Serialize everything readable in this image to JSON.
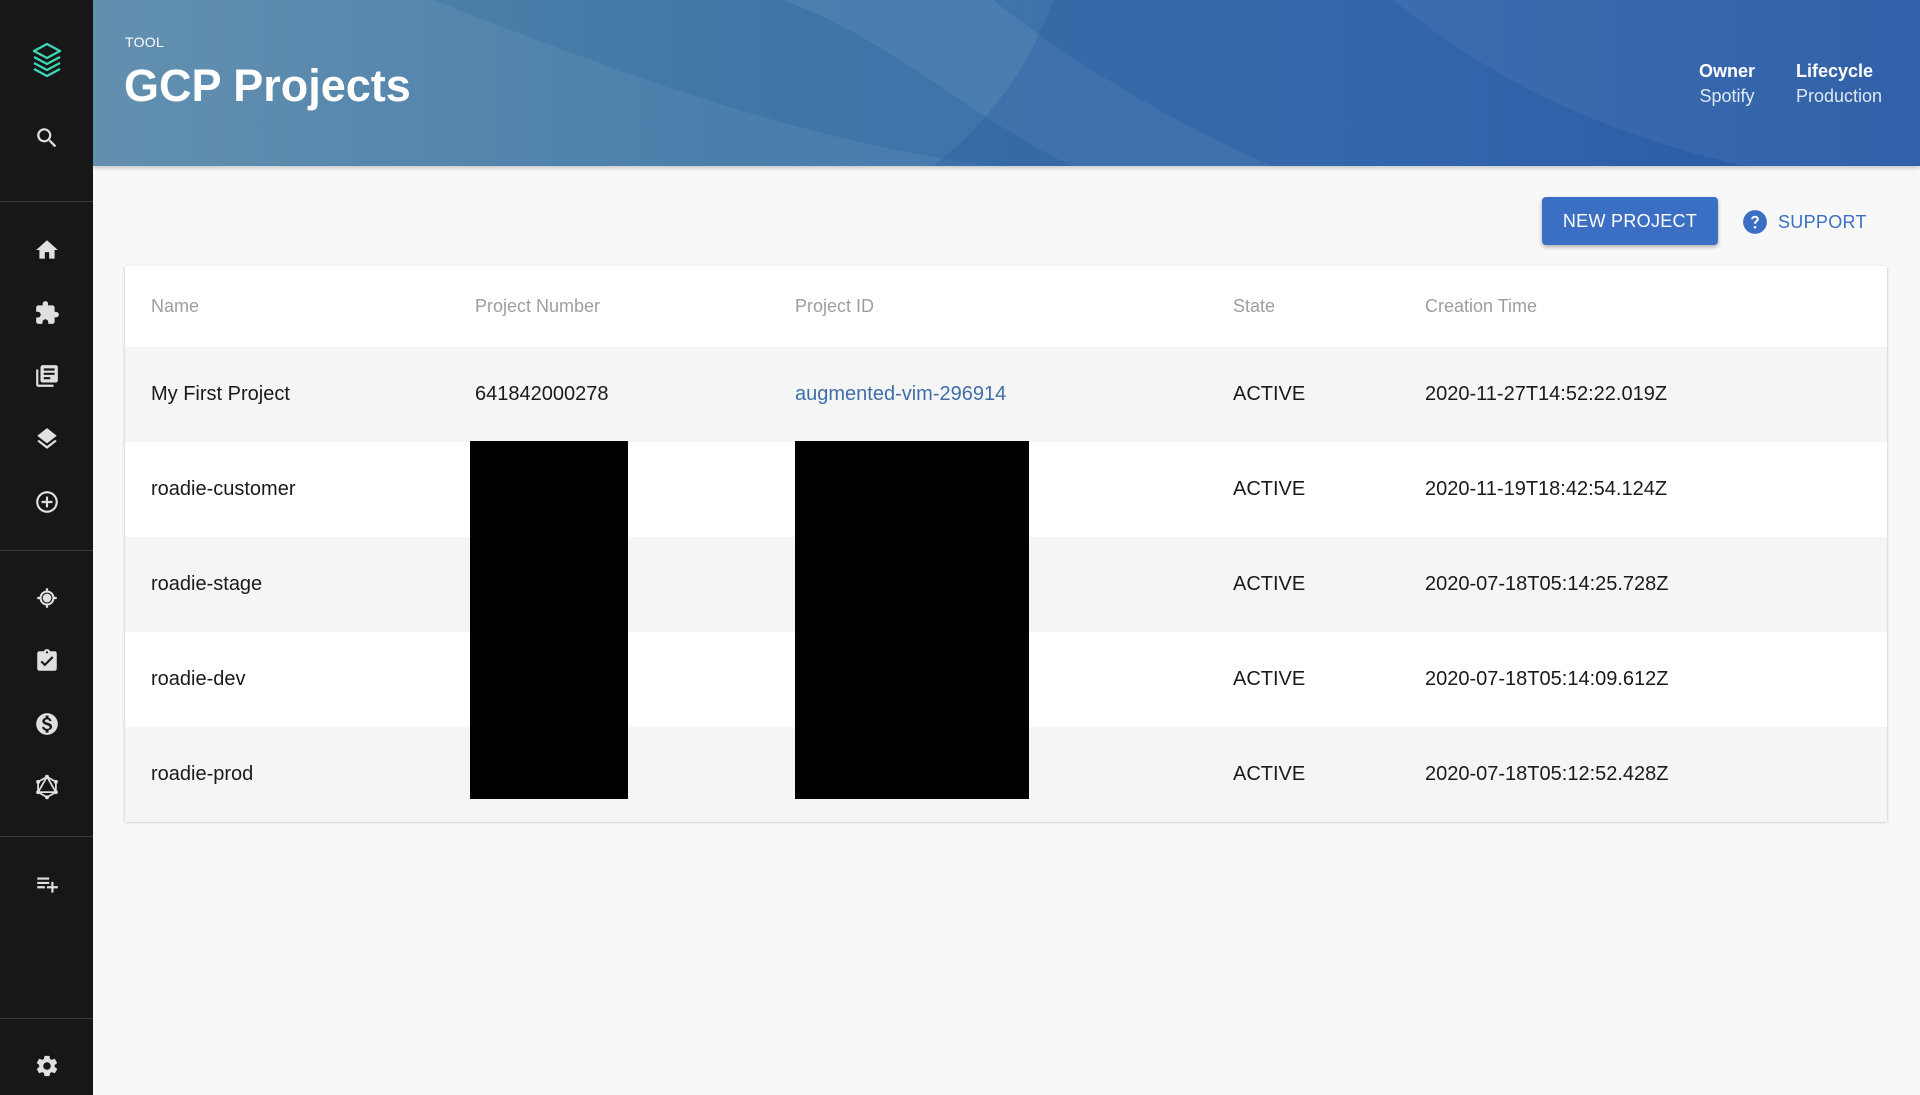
{
  "sidebar": {
    "items": [
      {
        "icon": "logo-icon"
      },
      {
        "icon": "search-icon"
      },
      {
        "icon": "home-icon"
      },
      {
        "icon": "puzzle-icon"
      },
      {
        "icon": "library-books-icon"
      },
      {
        "icon": "layers-icon"
      },
      {
        "icon": "add-circle-icon"
      },
      {
        "icon": "target-icon"
      },
      {
        "icon": "assignment-check-icon"
      },
      {
        "icon": "dollar-icon"
      },
      {
        "icon": "graphql-icon"
      },
      {
        "icon": "playlist-add-icon"
      },
      {
        "icon": "settings-icon"
      }
    ]
  },
  "header": {
    "type_label": "TOOL",
    "title": "GCP Projects",
    "owner_label": "Owner",
    "owner_value": "Spotify",
    "lifecycle_label": "Lifecycle",
    "lifecycle_value": "Production"
  },
  "actions": {
    "new_project": "NEW PROJECT",
    "support": "SUPPORT"
  },
  "table": {
    "columns": [
      "Name",
      "Project Number",
      "Project ID",
      "State",
      "Creation Time"
    ],
    "rows": [
      {
        "name": "My First Project",
        "number": "641842000278",
        "id": "augmented-vim-296914",
        "state": "ACTIVE",
        "time": "2020-11-27T14:52:22.019Z"
      },
      {
        "name": "roadie-customer",
        "number": "",
        "id": "",
        "state": "ACTIVE",
        "time": "2020-11-19T18:42:54.124Z"
      },
      {
        "name": "roadie-stage",
        "number": "",
        "id": "",
        "state": "ACTIVE",
        "time": "2020-07-18T05:14:25.728Z"
      },
      {
        "name": "roadie-dev",
        "number": "",
        "id": "",
        "state": "ACTIVE",
        "time": "2020-07-18T05:14:09.612Z"
      },
      {
        "name": "roadie-prod",
        "number": "",
        "id": "",
        "state": "ACTIVE",
        "time": "2020-07-18T05:12:52.428Z"
      }
    ]
  },
  "colors": {
    "sidebar_bg": "#171717",
    "primary": "#3b6fc4",
    "link": "#3f6fa9",
    "redaction": "#000000"
  }
}
